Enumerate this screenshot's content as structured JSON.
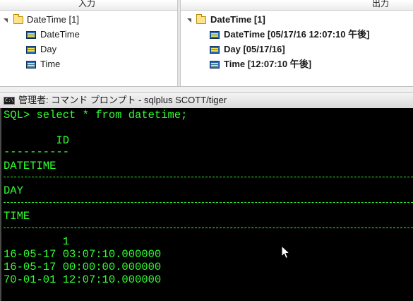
{
  "left_panel": {
    "header": "入力",
    "root": {
      "label": "DateTime [1]",
      "icon": "folder-icon"
    },
    "items": [
      {
        "label": "DateTime",
        "icon": "field-icon"
      },
      {
        "label": "Day",
        "icon": "field-icon"
      },
      {
        "label": "Time",
        "icon": "field-icon"
      }
    ]
  },
  "right_panel": {
    "header": "出力",
    "root": {
      "label": "DateTime [1]",
      "icon": "folder-icon"
    },
    "items": [
      {
        "label": "DateTime [05/17/16 12:07:10 午後]",
        "icon": "field-icon"
      },
      {
        "label": "Day [05/17/16]",
        "icon": "field-icon"
      },
      {
        "label": "Time [12:07:10 午後]",
        "icon": "field-icon"
      }
    ]
  },
  "console_window": {
    "icon_text": "C:\\",
    "title": "管理者: コマンド プロンプト - sqlplus  SCOTT/tiger",
    "text_color": "#31ff31",
    "background": "#000000",
    "lines": {
      "prompt": "SQL> select * from datetime;",
      "col_id": "        ID",
      "col_id_underline": "----------",
      "col_datetime": "DATETIME",
      "col_day": "DAY",
      "col_time": "TIME",
      "val_id": "         1",
      "val_datetime": "16-05-17 03:07:10.000000",
      "val_day": "16-05-17 00:00:00.000000",
      "val_time": "70-01-01 12:07:10.000000"
    }
  },
  "colors": {
    "folder": "#ffe38a",
    "field": "#2a6ab8",
    "console_text": "#31ff31"
  }
}
